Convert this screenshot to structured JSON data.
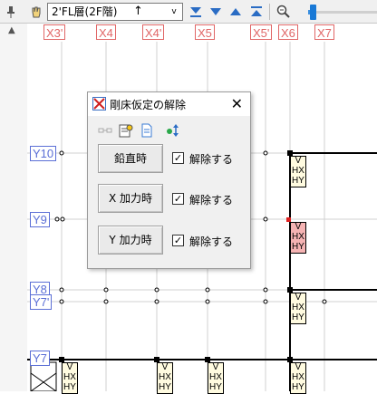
{
  "toolbar": {
    "floor_select_value": "2'FL層(2F階)",
    "floor_up_arrow": "↑",
    "dropdown_arrow": "v",
    "icons": [
      "pin-icon",
      "hand-icon",
      "move-bottom-icon",
      "move-down-icon",
      "move-up-icon",
      "move-top-icon",
      "zoom-icon"
    ],
    "zoom_level_fraction": 0.06
  },
  "columns": [
    "X3'",
    "X4",
    "X4'",
    "X5",
    "X5'",
    "X6",
    "X7"
  ],
  "rows": [
    "Y10",
    "Y9",
    "Y8",
    "Y7'",
    "Y7"
  ],
  "member_tags": [
    "V",
    "HX",
    "HY"
  ],
  "dialog": {
    "title": "剛床仮定の解除",
    "close": "✕",
    "icons": [
      "link-icon",
      "properties-icon",
      "document-icon",
      "move-updown-icon"
    ],
    "rows": [
      {
        "button": "鉛直時",
        "checked": true,
        "label": "解除する"
      },
      {
        "button": "X 加力時",
        "checked": true,
        "label": "解除する"
      },
      {
        "button": "Y 加力時",
        "checked": true,
        "label": "解除する"
      }
    ],
    "check_mark": "✓"
  },
  "colors": {
    "column_label": "#e06666",
    "row_label": "#5b6fd6",
    "highlight_tag": "#f5b3b3",
    "zoom_accent": "#1979d6"
  }
}
